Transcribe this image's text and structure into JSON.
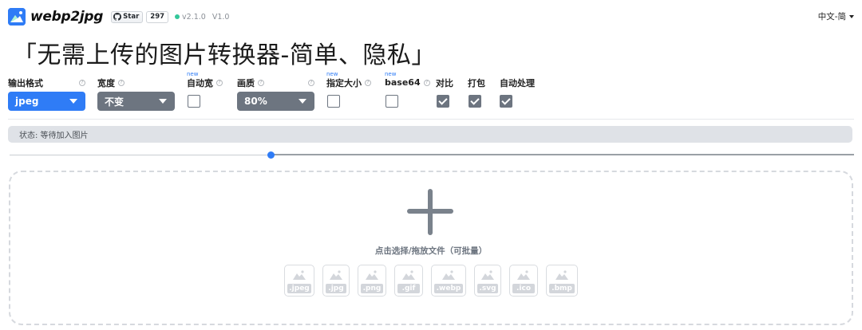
{
  "header": {
    "brand": "webp2jpg",
    "github_star_label": "Star",
    "github_star_count": "297",
    "version": "v2.1.0",
    "version2": "V1.0",
    "language": "中文-简"
  },
  "title": "「无需上传的图片转换器-简单、隐私」",
  "options": {
    "format_label": "输出格式",
    "format_value": "jpeg",
    "width_label": "宽度",
    "width_value": "不变",
    "auto_width_label": "自动宽",
    "auto_width_new": "new",
    "quality_label": "画质",
    "quality_value": "80%",
    "fixed_size_label": "指定大小",
    "fixed_size_new": "new",
    "base64_label": "base64",
    "base64_new": "new",
    "compare_label": "对比",
    "pack_label": "打包",
    "auto_process_label": "自动处理",
    "help_glyph": "?"
  },
  "status": {
    "text": "状态: 等待加入图片"
  },
  "slider": {
    "value_fraction": 0.31
  },
  "dropzone": {
    "hint": "点击选择/拖放文件（可批量）",
    "formats": [
      ".jpeg",
      ".jpg",
      ".png",
      ".gif",
      ".webp",
      ".svg",
      ".ico",
      ".bmp"
    ]
  },
  "colors": {
    "accent": "#2f7cf6",
    "gray_control": "#6d7580",
    "status_bg": "#dfe2e7",
    "online_dot": "#34c79a"
  }
}
